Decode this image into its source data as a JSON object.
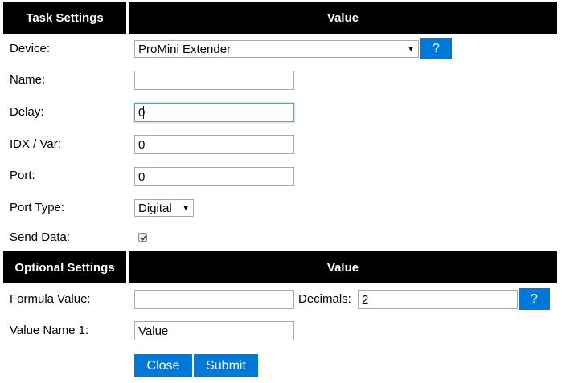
{
  "task_header": {
    "col1": "Task Settings",
    "col2": "Value"
  },
  "fields": {
    "device": {
      "label": "Device:",
      "value": "ProMini Extender",
      "help": "?"
    },
    "name": {
      "label": "Name:",
      "value": ""
    },
    "delay": {
      "label": "Delay:",
      "value": "0"
    },
    "idx": {
      "label": "IDX / Var:",
      "value": "0"
    },
    "port": {
      "label": "Port:",
      "value": "0"
    },
    "port_type": {
      "label": "Port Type:",
      "value": "Digital"
    },
    "send_data": {
      "label": "Send Data:",
      "checked": true
    }
  },
  "optional_header": {
    "col1": "Optional Settings",
    "col2": "Value"
  },
  "optional": {
    "formula": {
      "label": "Formula Value:",
      "value": ""
    },
    "decimals": {
      "label": "Decimals:",
      "value": "2",
      "help": "?"
    },
    "value_name_1": {
      "label": "Value Name 1:",
      "value": "Value"
    }
  },
  "buttons": {
    "close": "Close",
    "submit": "Submit"
  },
  "colors": {
    "header_bg": "#000000",
    "button_bg": "#0078d7",
    "focus_border": "#5b9dd9"
  }
}
